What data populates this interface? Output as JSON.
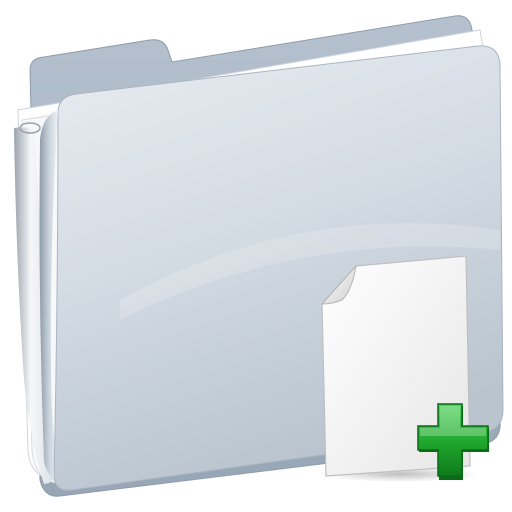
{
  "icon": {
    "name": "folder-add-document-icon",
    "colors": {
      "folder_back": "#a9b6c4",
      "folder_front_top": "#e3e8ee",
      "folder_front_bottom": "#b7c2cd",
      "paper": "#ffffff",
      "document": "#f3f3f3",
      "plus_green": "#22a832",
      "plus_dark_green": "#0d7a1a"
    }
  }
}
